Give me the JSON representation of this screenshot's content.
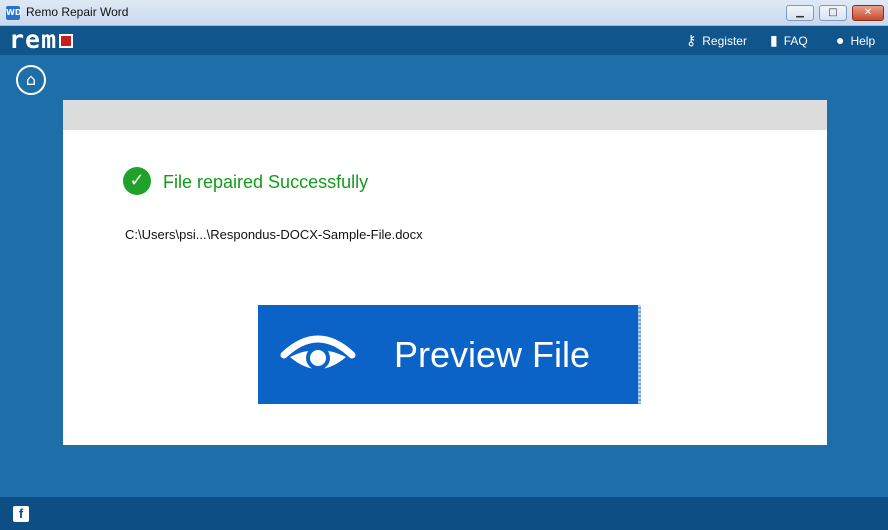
{
  "window": {
    "app_icon": "WD",
    "title": "Remo Repair Word",
    "minimize_glyph": "▁",
    "maximize_glyph": "□",
    "close_glyph": "✕"
  },
  "header": {
    "logo_text": "rem",
    "nav": [
      {
        "icon": "key-icon",
        "label": "Register"
      },
      {
        "icon": "book-icon",
        "label": "FAQ"
      },
      {
        "icon": "user-icon",
        "label": "Help"
      }
    ]
  },
  "main": {
    "status_message": "File repaired Successfully",
    "file_path": "C:\\Users\\psi...\\Respondus-DOCX-Sample-File.docx",
    "preview_button_label": "Preview File"
  },
  "footer": {
    "facebook_glyph": "f"
  },
  "colors": {
    "background": "#1e6fa9",
    "topbar": "#10558c",
    "success_green": "#129b1b",
    "button_blue": "#0b63c7",
    "logo_accent": "#c81e1e"
  }
}
